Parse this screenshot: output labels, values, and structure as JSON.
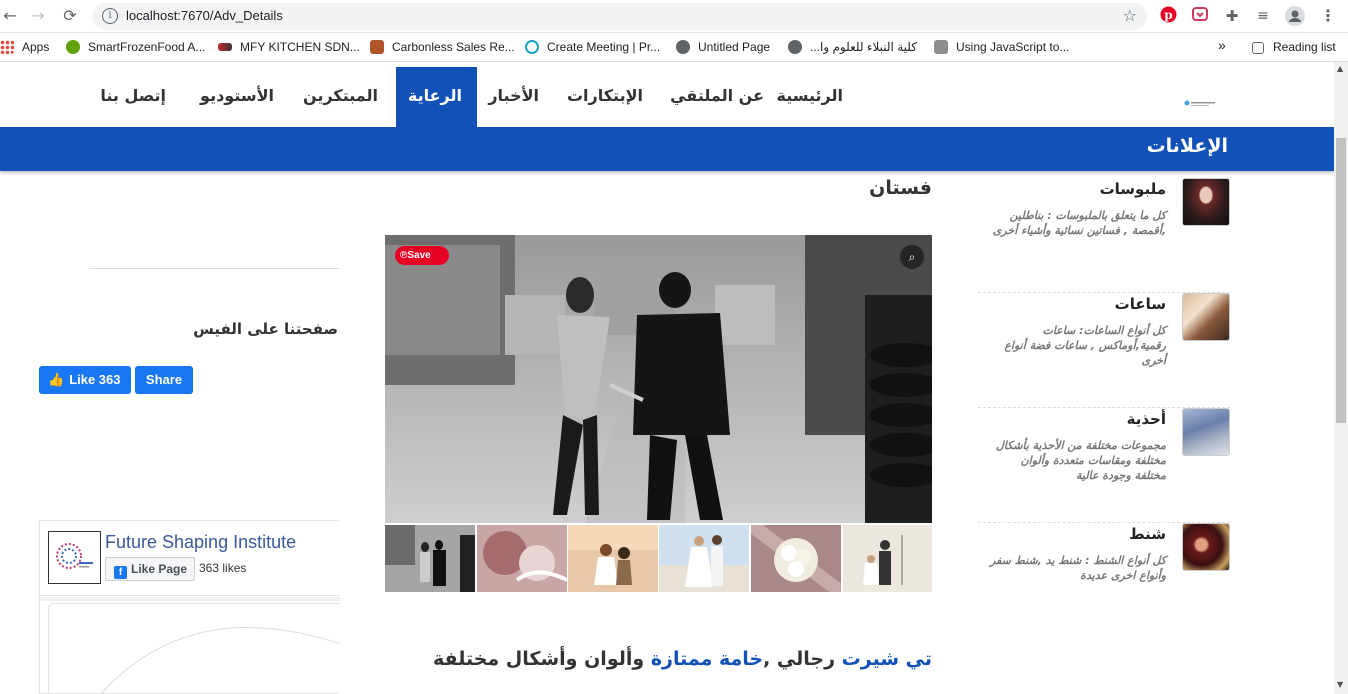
{
  "browser": {
    "url": "localhost:7670/Adv_Details",
    "bookmarks": [
      {
        "label": "Apps",
        "icon": "apps-grid-icon",
        "color": "#4285f4"
      },
      {
        "label": "SmartFrozenFood A...",
        "icon": "globe-green-icon",
        "color": "#5fa20c"
      },
      {
        "label": "MFY KITCHEN SDN...",
        "icon": "mfy-logo-icon",
        "color": "#c62828"
      },
      {
        "label": "Carbonless Sales Re...",
        "icon": "paper-icon",
        "color": "#b0552a"
      },
      {
        "label": "Create Meeting | Pr...",
        "icon": "meeting-icon",
        "color": "#1aa3c9"
      },
      {
        "label": "Untitled Page",
        "icon": "globe-icon",
        "color": "#5f6368"
      },
      {
        "label": "كلية النبلاء للعلوم وا...",
        "icon": "globe-icon",
        "color": "#5f6368"
      },
      {
        "label": "Using JavaScript to...",
        "icon": "js-icon",
        "color": "#8e8e8e"
      }
    ],
    "overflow": "»",
    "reading_list": "Reading list"
  },
  "site_nav": {
    "items": [
      {
        "label": "الرئيسية",
        "active": false
      },
      {
        "label": "عن الملتقي",
        "active": false
      },
      {
        "label": "الإبتكارات",
        "active": false
      },
      {
        "label": "الأخبار",
        "active": false
      },
      {
        "label": "الرعاية",
        "active": true
      },
      {
        "label": "المبتكرين",
        "active": false
      },
      {
        "label": "الأستوديو",
        "active": false
      },
      {
        "label": "إتصل بنا",
        "active": false
      }
    ],
    "accent": "#1151b8"
  },
  "section_title": "الإعلانات",
  "categories": [
    {
      "title": "ملبوسات",
      "desc": "كل ما يتعلق بالملبوسات : بناطلين ,أقمصة , فساتين نسائية وأشياء أخرى"
    },
    {
      "title": "ساعات",
      "desc": "كل أنواع الساعات: ساعات رقمية,أوماكس , ساعات فضة أنواع أخرى"
    },
    {
      "title": "أحذية",
      "desc": "مجموعات مختلفة من الأحذية بأشكال مختلفة ومقاسات متعددة وألوان مختلفة وجودة عالية"
    },
    {
      "title": "شنط",
      "desc": "كل أنواع الشنط : شنط يد ,شنط سفر وأنواع اخرى عديدة"
    }
  ],
  "product": {
    "title": "فستان",
    "save_label": "Save",
    "desc_parts": [
      {
        "text": "تي شيرت",
        "blue": true
      },
      {
        "text": " رجالي ,",
        "blue": false
      },
      {
        "text": "خامة ممتازة",
        "blue": true
      },
      {
        "text": " وألوان وأشكال مختلفة",
        "blue": false
      }
    ]
  },
  "facebook": {
    "heading": "صفحتنا على الفيس",
    "like_label": "Like 363",
    "share_label": "Share",
    "page_name": "Future Shaping Institute",
    "page_like_label": "Like Page",
    "likes": "363 likes",
    "color": "#1877f2"
  }
}
